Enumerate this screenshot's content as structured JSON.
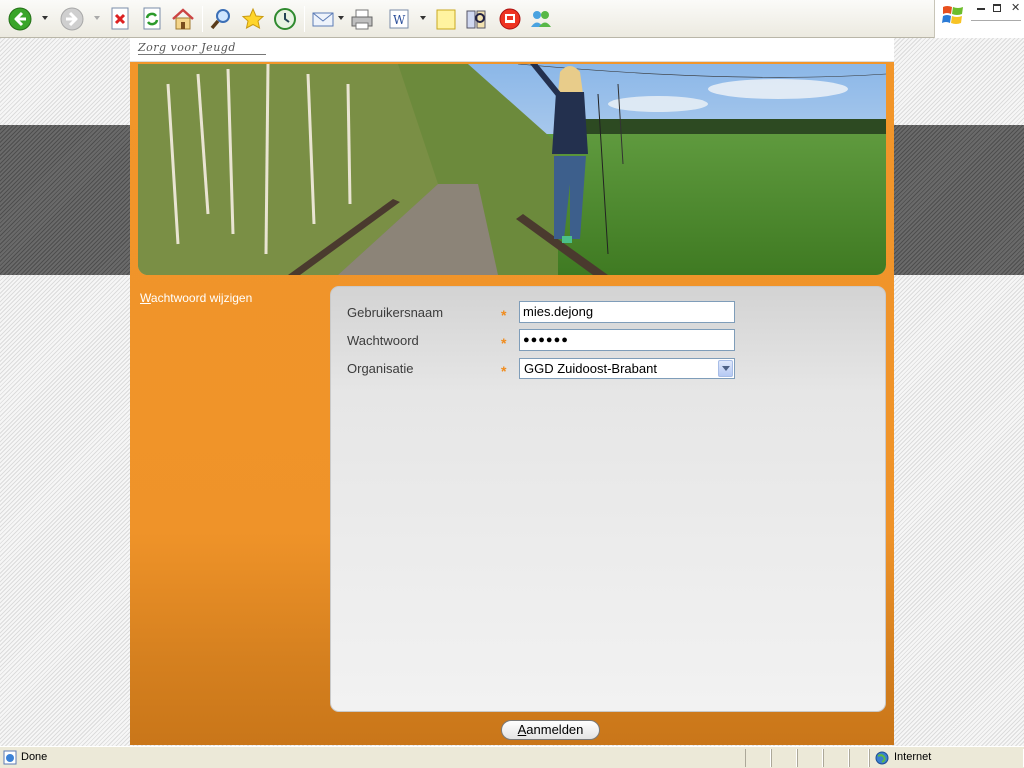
{
  "brand": {
    "logo_text": "Zorg voor Jeugd"
  },
  "sidebar": {
    "link_first": "W",
    "link_rest": "achtwoord wijzigen"
  },
  "form": {
    "username_label": "Gebruikersnaam",
    "username_value": "mies.dejong",
    "password_label": "Wachtwoord",
    "password_value": "●●●●●●",
    "org_label": "Organisatie",
    "org_value": "GGD Zuidoost-Brabant",
    "required_marker": "*"
  },
  "buttons": {
    "login_first": "A",
    "login_rest": "anmelden"
  },
  "statusbar": {
    "status": "Done",
    "zone": "Internet"
  },
  "toolbar": {
    "icons": [
      "back-icon",
      "forward-icon",
      "stop-icon",
      "refresh-icon",
      "home-icon",
      "search-icon",
      "favorites-icon",
      "history-icon",
      "mail-icon",
      "print-icon",
      "edit-icon",
      "notes-icon",
      "research-icon",
      "messenger-alert-icon",
      "messenger-icon"
    ]
  },
  "colors": {
    "accent": "#f0932a",
    "accent_dark": "#c97619",
    "panel": "#efefef",
    "required": "#f08c1e"
  }
}
